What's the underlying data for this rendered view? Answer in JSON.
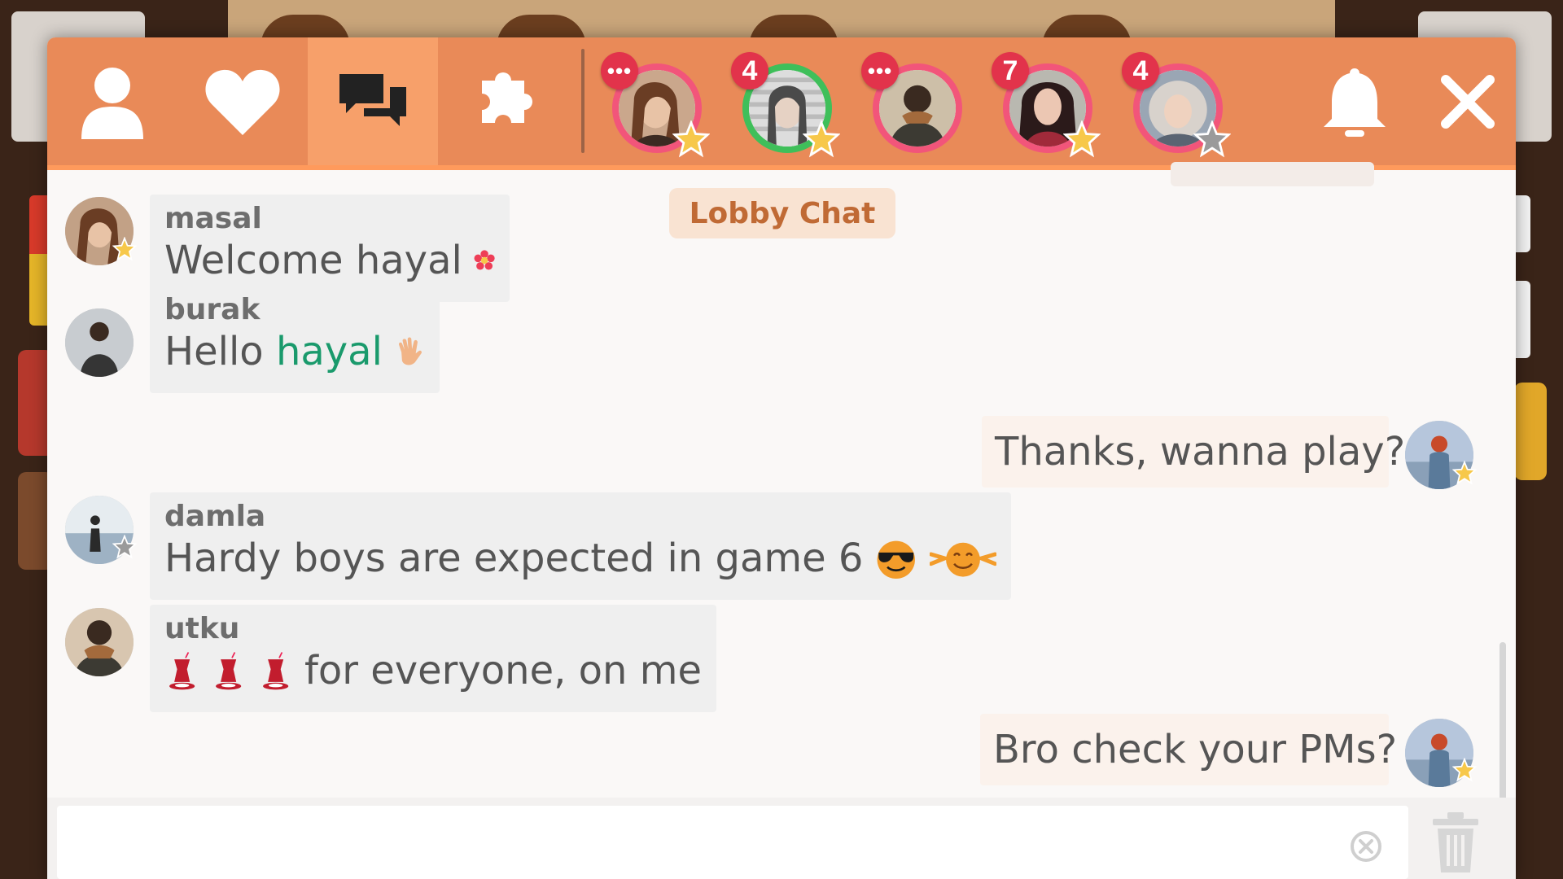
{
  "topbar": {
    "tabs": [
      {
        "name": "profile",
        "icon": "user-icon"
      },
      {
        "name": "favorites",
        "icon": "heart-icon"
      },
      {
        "name": "chat",
        "icon": "chat-bubbles-icon",
        "active": true
      },
      {
        "name": "games",
        "icon": "puzzle-icon"
      }
    ],
    "conversations": [
      {
        "badge": "•••",
        "ring": "pink",
        "star": "gold"
      },
      {
        "badge": "4",
        "ring": "green",
        "star": "gold"
      },
      {
        "badge": "•••",
        "ring": "pink",
        "star": "none"
      },
      {
        "badge": "7",
        "ring": "pink",
        "star": "gold"
      },
      {
        "badge": "4",
        "ring": "pink",
        "star": "gray"
      }
    ],
    "bell_icon": "bell-icon",
    "close_icon": "close-icon"
  },
  "chat": {
    "title": "Lobby Chat",
    "messages": [
      {
        "author": "masal",
        "text": "Welcome hayal",
        "emoji": "flower",
        "own": false
      },
      {
        "author": "burak",
        "text": "Hello",
        "mention": "hayal",
        "emoji": "wave",
        "own": false
      },
      {
        "author": "me",
        "text": "Thanks, wanna play?",
        "own": true
      },
      {
        "author": "damla",
        "text": "Hardy boys are expected in game 6",
        "emoji": "sunglasses, happy",
        "own": false
      },
      {
        "author": "utku",
        "text": "for everyone, on me",
        "emoji": "tea x3",
        "own": false
      },
      {
        "author": "me",
        "text": "Bro check your PMs?",
        "own": true
      }
    ]
  },
  "composer": {
    "value": "",
    "placeholder": "",
    "clear_icon": "clear-icon",
    "trash_icon": "trash-icon"
  },
  "colors": {
    "topbar": "#e98a58",
    "active_tab": "#f7a06a",
    "badge": "#e2334b",
    "mention": "#1a9a6c",
    "lobby_chip_text": "#c06a35"
  }
}
